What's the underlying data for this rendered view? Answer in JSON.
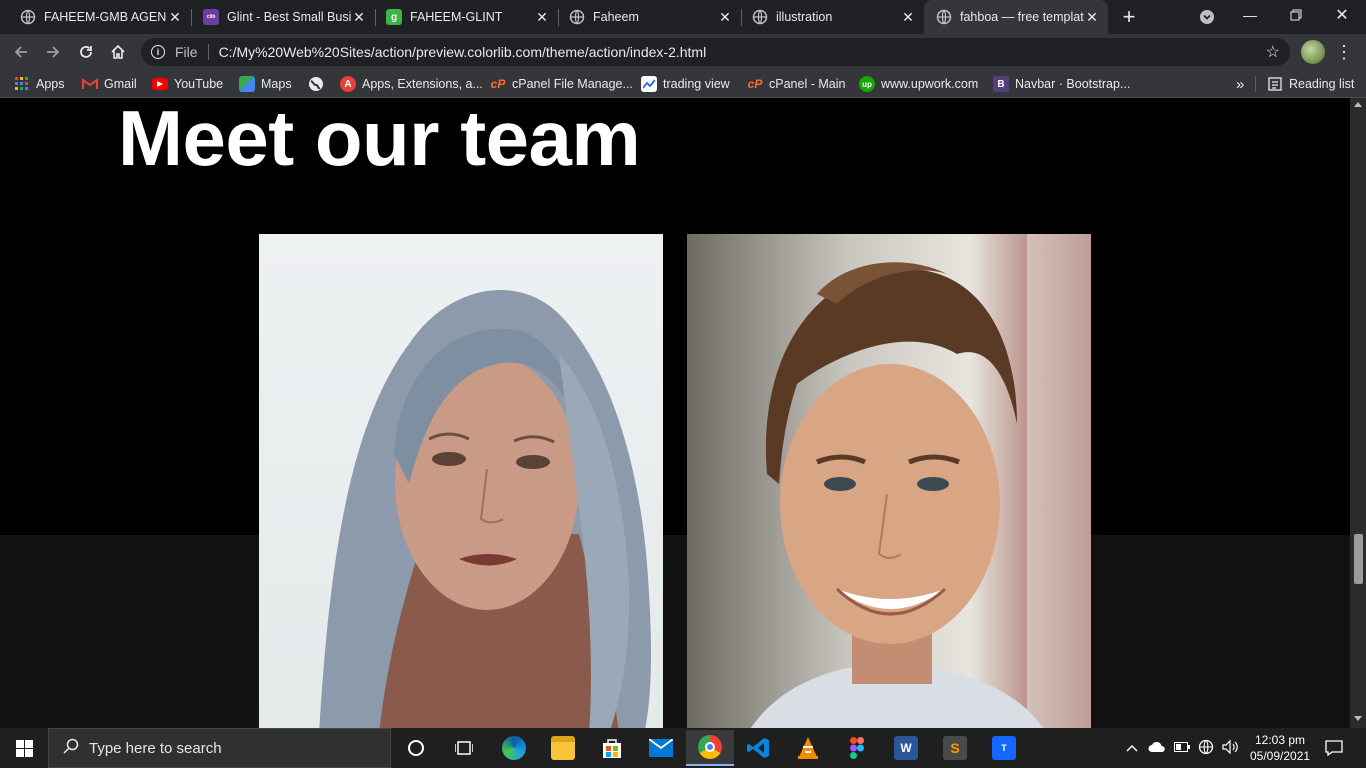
{
  "tabs": [
    {
      "title": "FAHEEM-GMB AGENCY",
      "favicon": "globe-icon"
    },
    {
      "title": "Glint - Best Small Business",
      "favicon": "colorlib-icon"
    },
    {
      "title": "FAHEEM-GLINT",
      "favicon": "g-icon"
    },
    {
      "title": "Faheem",
      "favicon": "globe-icon"
    },
    {
      "title": "illustration",
      "favicon": "globe-icon"
    },
    {
      "title": "fahboa — free template",
      "favicon": "globe-icon"
    }
  ],
  "address_bar": {
    "scheme_label": "File",
    "url": "C:/My%20Web%20Sites/action/preview.colorlib.com/theme/action/index-2.html"
  },
  "bookmarks": [
    {
      "label": "Apps",
      "icon": "apps-grid-icon"
    },
    {
      "label": "Gmail",
      "icon": "gmail-icon"
    },
    {
      "label": "YouTube",
      "icon": "youtube-icon"
    },
    {
      "label": "Maps",
      "icon": "maps-icon"
    },
    {
      "label": "",
      "icon": "globe-icon"
    },
    {
      "label": "Apps, Extensions, a...",
      "icon": "webstore-icon"
    },
    {
      "label": "cPanel File Manage...",
      "icon": "cpanel-icon"
    },
    {
      "label": "trading view",
      "icon": "tradingview-icon"
    },
    {
      "label": "cPanel - Main",
      "icon": "cpanel-icon"
    },
    {
      "label": "www.upwork.com",
      "icon": "upwork-icon"
    },
    {
      "label": "Navbar · Bootstrap...",
      "icon": "bootstrap-icon"
    }
  ],
  "reading_list_label": "Reading list",
  "overflow_label": "»",
  "page": {
    "heading": "Meet our team",
    "team_photos": [
      {
        "subject": "woman with blue-grey hair",
        "alt": "team member"
      },
      {
        "subject": "smiling man with brown hair",
        "alt": "team member"
      }
    ]
  },
  "taskbar": {
    "search_placeholder": "Type here to search",
    "time": "12:03 pm",
    "date": "05/09/2021",
    "apps": [
      "cortana-icon",
      "task-view-icon",
      "edge-icon",
      "file-explorer-icon",
      "store-icon",
      "mail-icon",
      "chrome-icon",
      "vscode-icon",
      "vlc-icon",
      "figma-icon",
      "word-icon",
      "sublime-icon",
      "typora-icon"
    ]
  },
  "colors": {
    "tab_bar": "#202124",
    "toolbar": "#35363a",
    "page_bg": "#000000",
    "page_lower_bg": "#121212",
    "taskbar": "#1f1f1f"
  }
}
